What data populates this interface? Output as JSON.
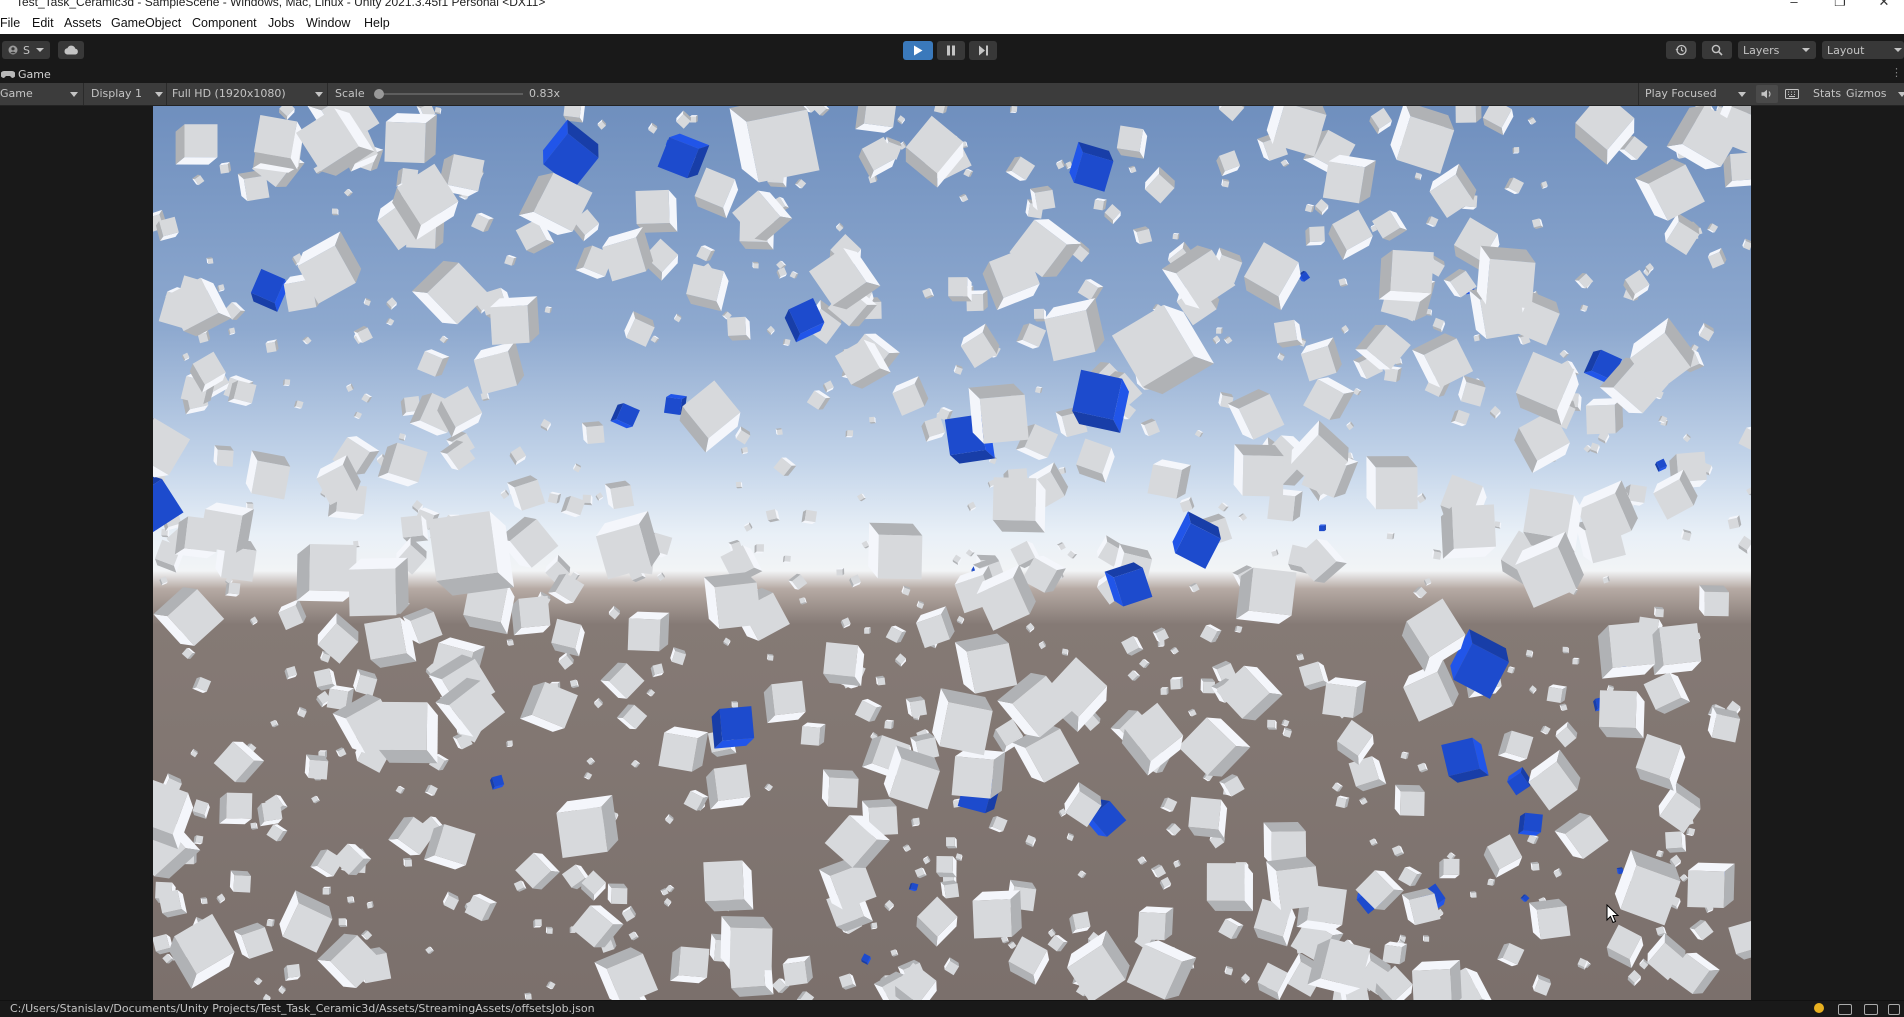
{
  "window": {
    "title": "Test_Task_Ceramic3d - SampleScene - Windows, Mac, Linux - Unity 2021.3.45f1 Personal <DX11>",
    "controls": [
      "minimize-icon",
      "restore-icon",
      "close-icon"
    ]
  },
  "menu": [
    "File",
    "Edit",
    "Assets",
    "GameObject",
    "Component",
    "Jobs",
    "Window",
    "Help"
  ],
  "toolbar": {
    "account_label": "S",
    "play_icon": "play-icon",
    "pause_icon": "pause-icon",
    "step_icon": "step-icon",
    "layers_label": "Layers",
    "layout_label": "Layout",
    "accent_color": "#3a79bb"
  },
  "tab": {
    "label": "Game",
    "icon": "gamepad-icon"
  },
  "game_toolbar": {
    "view_mode": "Game",
    "display": "Display 1",
    "resolution": "Full HD (1920x1080)",
    "scale_label": "Scale",
    "scale_value": "0.83x",
    "scale_fraction": 0.0,
    "play_mode": "Play Focused",
    "stats_label": "Stats",
    "gizmos_label": "Gizmos"
  },
  "scene": {
    "sky_top_color": "#6f8fbe",
    "horizon_color": "#f2f4f6",
    "ground_color": "#7b706c",
    "cube_color": "#e2e4e8",
    "highlight_cube_color": "#1f4fd8"
  },
  "statusbar": {
    "path": "C:/Users/Stanislav/Documents/Unity Projects/Test_Task_Ceramic3d/Assets/StreamingAssets/offsetsJob.json"
  }
}
